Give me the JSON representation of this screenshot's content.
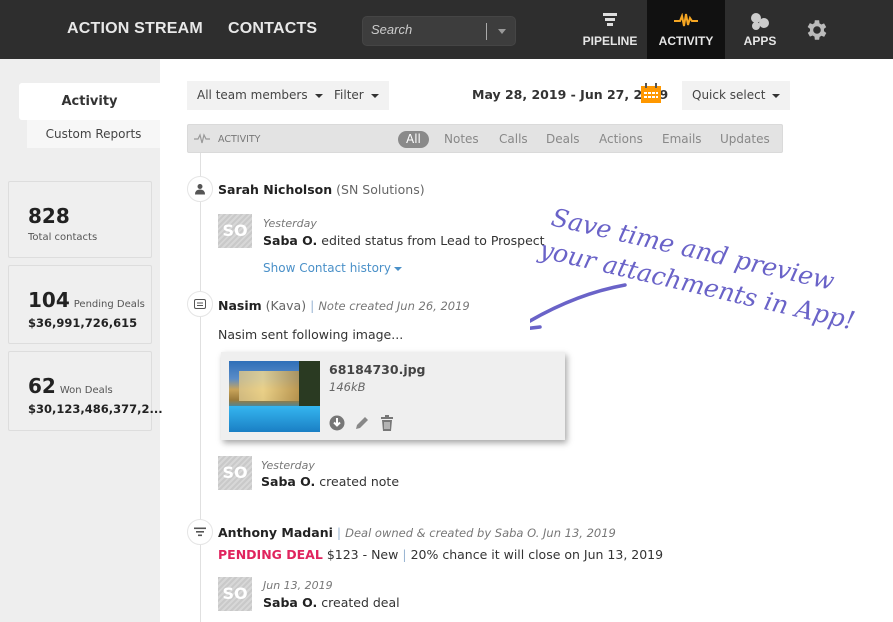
{
  "topbar": {
    "nav": [
      "ACTION STREAM",
      "CONTACTS"
    ],
    "search_placeholder": "Search",
    "tabs": [
      {
        "label": "PIPELINE",
        "icon": "funnel-icon",
        "active": false
      },
      {
        "label": "ACTIVITY",
        "icon": "pulse-icon",
        "active": true
      },
      {
        "label": "APPS",
        "icon": "apps-icon",
        "active": false
      }
    ],
    "settings_icon": "gear-icon",
    "accent_color": "#f5a623"
  },
  "sidebar": {
    "tabs": [
      "Activity",
      "Custom Reports"
    ],
    "stats": [
      {
        "number": "828",
        "label": "Total contacts"
      },
      {
        "number": "104",
        "label": "Pending Deals",
        "amount": "$36,991,726,615"
      },
      {
        "number": "62",
        "label": "Won Deals",
        "amount": "$30,123,486,377,2..."
      }
    ]
  },
  "toolbar": {
    "team_filter": "All team members",
    "filter": "Filter",
    "date_range": "May 28, 2019 - Jun 27, 2019",
    "quick_select": "Quick select"
  },
  "activity_bar": {
    "title": "ACTIVITY",
    "tabs": [
      "All",
      "Notes",
      "Calls",
      "Deals",
      "Actions",
      "Emails",
      "Updates"
    ],
    "active_tab": "All"
  },
  "feed": [
    {
      "type": "contact",
      "name": "Sarah Nicholson",
      "company": "(SN Solutions)",
      "entry": {
        "avatar": "SO",
        "when": "Yesterday",
        "user": "Saba O.",
        "action": "edited status from Lead to Prospect"
      },
      "link": "Show Contact history"
    },
    {
      "type": "note",
      "name": "Nasim",
      "company": "(Kava)",
      "meta": "Note created Jun 26, 2019",
      "body": "Nasim sent following image...",
      "attachment": {
        "filename": "68184730.jpg",
        "size": "146kB"
      },
      "entry": {
        "avatar": "SO",
        "when": "Yesterday",
        "user": "Saba O.",
        "action": "created note"
      }
    },
    {
      "type": "deal",
      "name": "Anthony Madani",
      "meta": "Deal owned & created by Saba O. Jun 13, 2019",
      "status": "PENDING DEAL",
      "deal_value": "$123 - New",
      "deal_detail": "20% chance it will close on Jun 13, 2019",
      "entry": {
        "avatar": "SO",
        "when": "Jun 13, 2019",
        "user": "Saba O.",
        "action": "created deal"
      }
    }
  ],
  "annotation": {
    "line1": "Save time and preview",
    "line2": "your attachments in App!",
    "color": "#6a63c8"
  }
}
